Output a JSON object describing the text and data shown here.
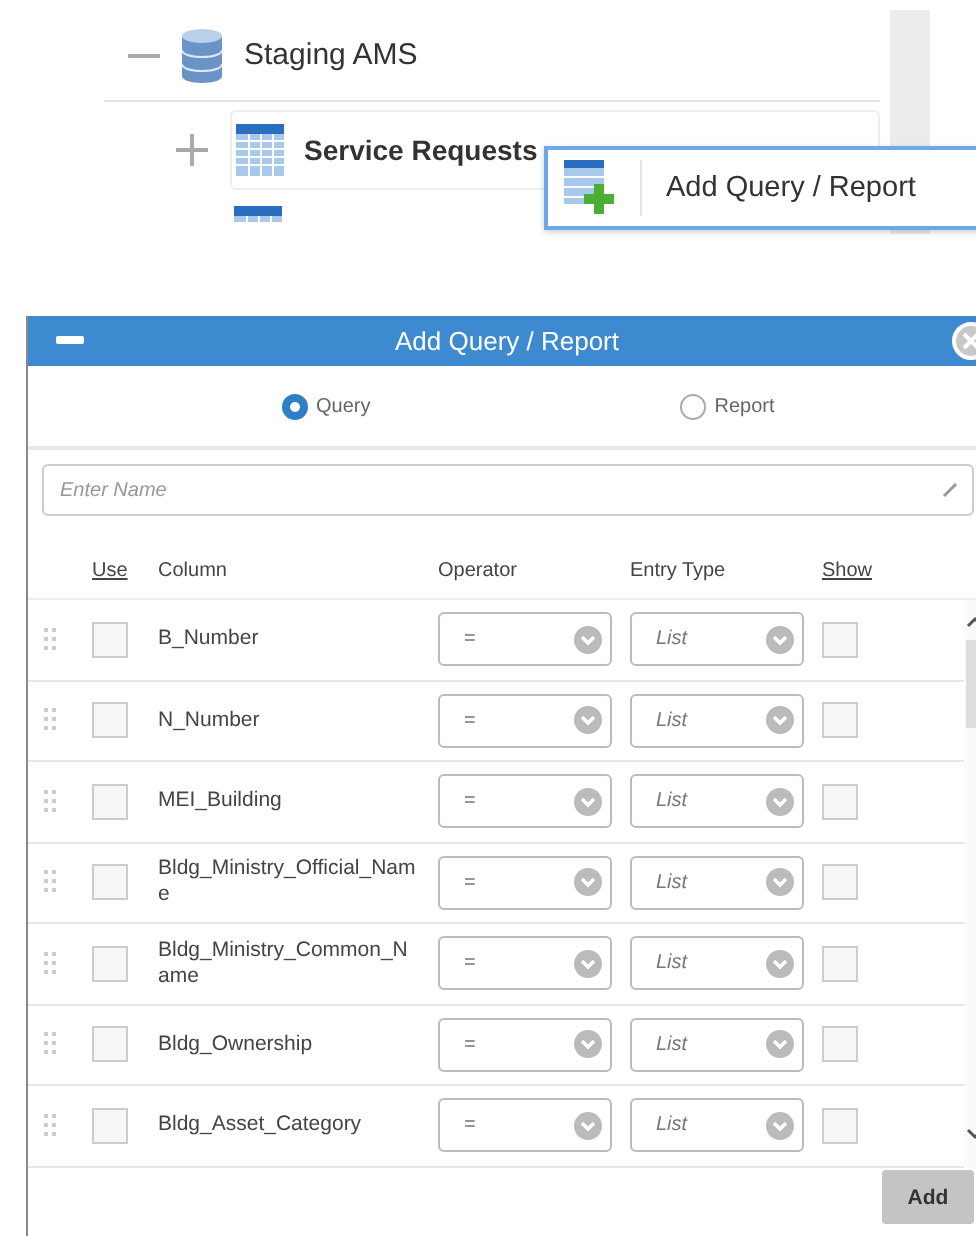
{
  "tree": {
    "root": {
      "label": "Staging AMS",
      "expanded": true,
      "children": [
        {
          "label": "Service Requests",
          "expanded": false
        }
      ]
    }
  },
  "context_menu": {
    "items": [
      {
        "label": "Add Query / Report"
      }
    ]
  },
  "dialog": {
    "title": "Add Query / Report",
    "mode_options": [
      {
        "label": "Query",
        "selected": true
      },
      {
        "label": "Report",
        "selected": false
      }
    ],
    "name_field": {
      "placeholder": "Enter Name"
    },
    "columns": [
      "Use",
      "Column",
      "Operator",
      "Entry Type",
      "Show"
    ],
    "rows": [
      {
        "use": false,
        "column": "B_Number",
        "operator": "=",
        "entry_type": "List",
        "show": false
      },
      {
        "use": false,
        "column": "N_Number",
        "operator": "=",
        "entry_type": "List",
        "show": false
      },
      {
        "use": false,
        "column": "MEI_Building",
        "operator": "=",
        "entry_type": "List",
        "show": false
      },
      {
        "use": false,
        "column": "Bldg_Ministry_Official_Name",
        "operator": "=",
        "entry_type": "List",
        "show": false
      },
      {
        "use": false,
        "column": "Bldg_Ministry_Common_Name",
        "operator": "=",
        "entry_type": "List",
        "show": false
      },
      {
        "use": false,
        "column": "Bldg_Ownership",
        "operator": "=",
        "entry_type": "List",
        "show": false
      },
      {
        "use": false,
        "column": "Bldg_Asset_Category",
        "operator": "=",
        "entry_type": "List",
        "show": false
      }
    ],
    "add_button": "Add"
  }
}
